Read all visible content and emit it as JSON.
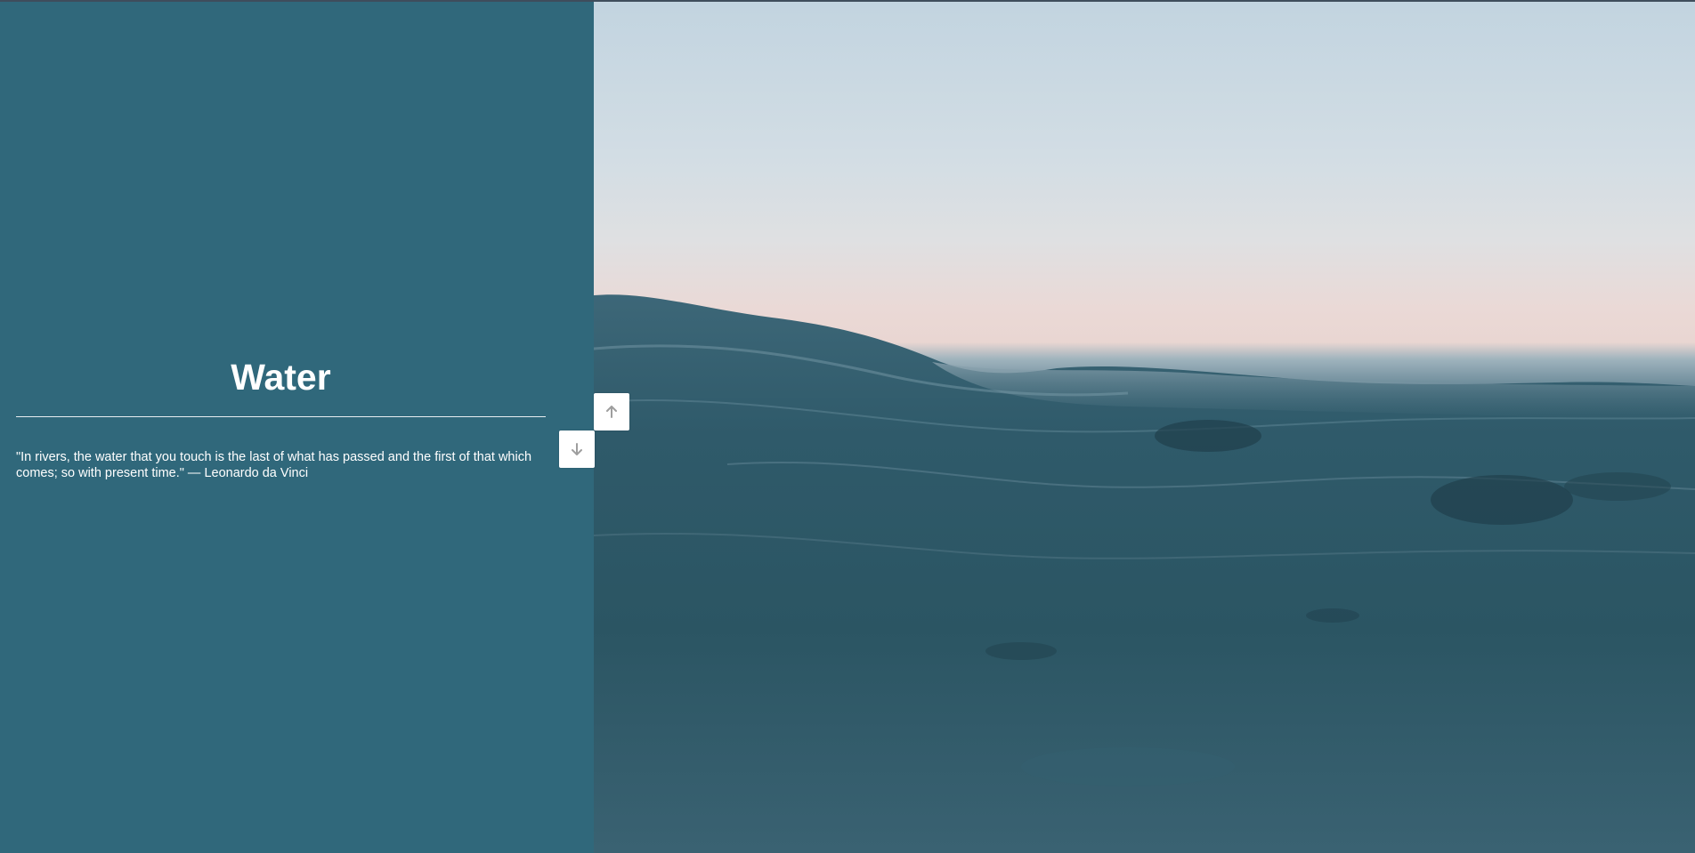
{
  "panel": {
    "title": "Water",
    "quote": "\"In rivers, the water that you touch is the last of what has passed and the first of that which comes; so with present time.\" — Leonardo da Vinci",
    "background_color": "#30687b"
  },
  "image": {
    "subject_icon": "ocean-wave-photo"
  },
  "navigation": {
    "up_icon": "arrow-up-icon",
    "down_icon": "arrow-down-icon",
    "icon_color": "#9e9e9e"
  }
}
